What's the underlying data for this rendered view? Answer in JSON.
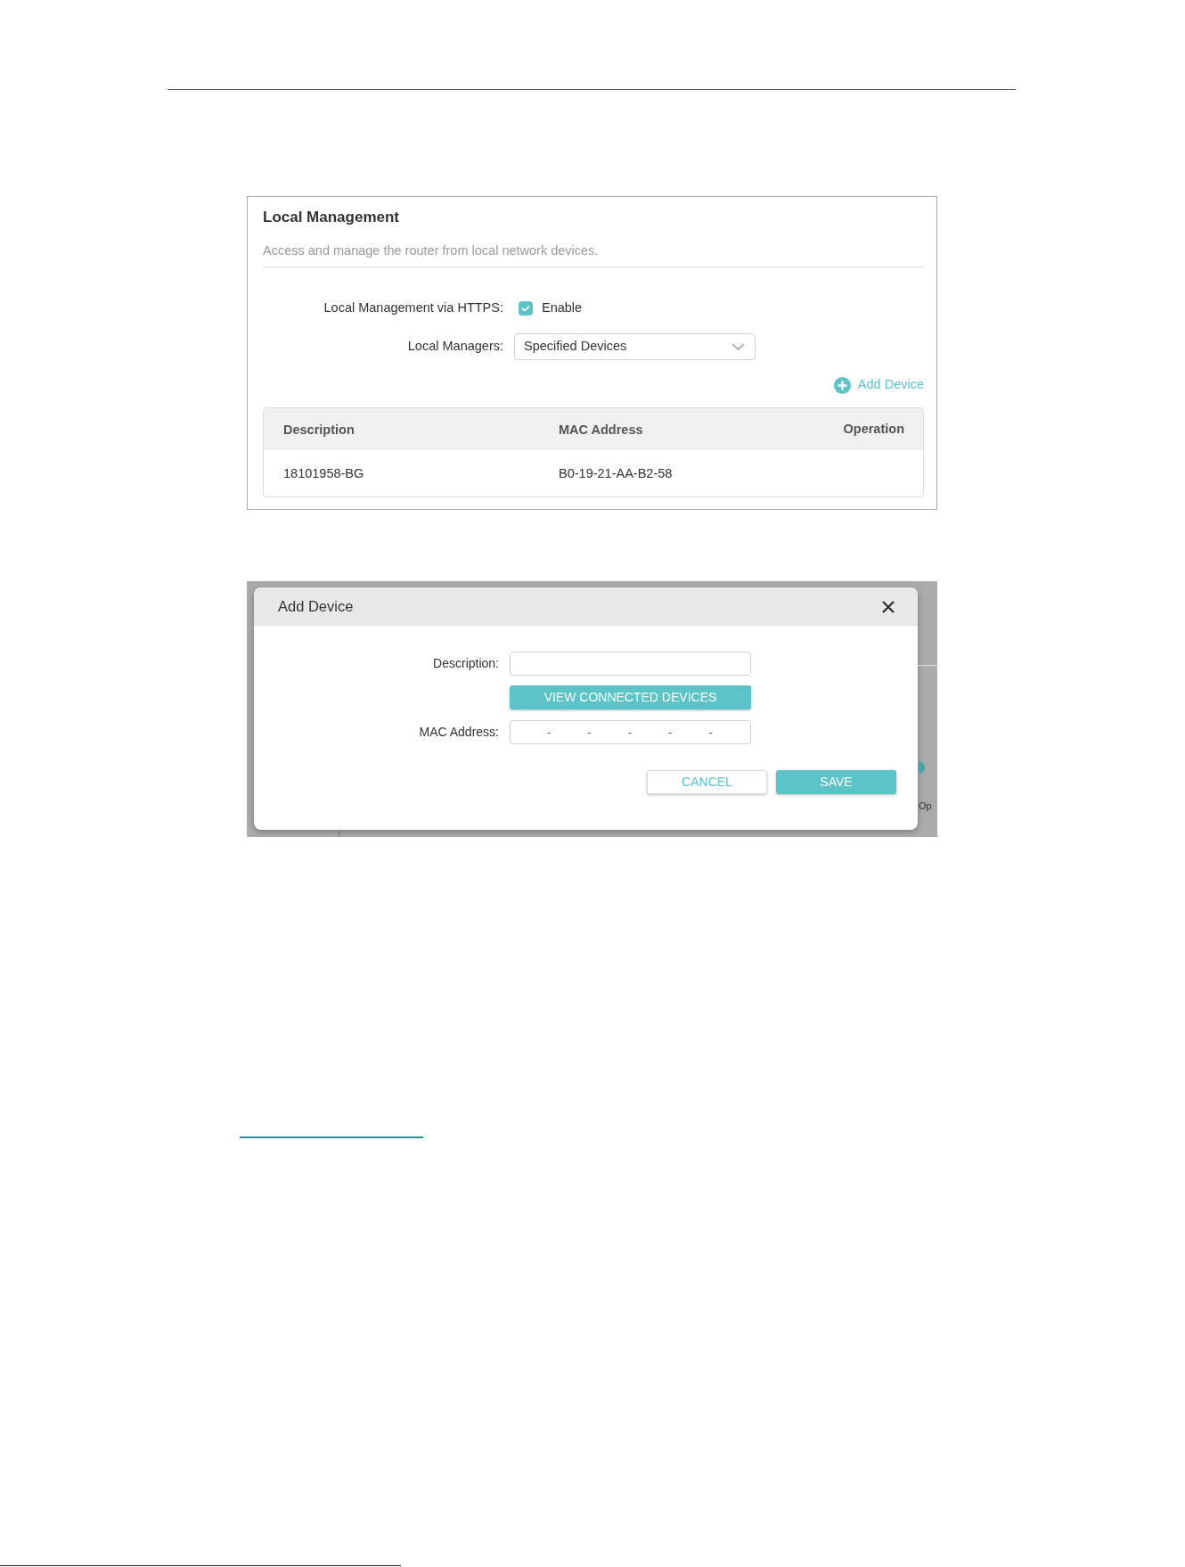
{
  "local_management": {
    "title": "Local Management",
    "description": "Access and manage the router from local network devices.",
    "https": {
      "label": "Local Management via HTTPS:",
      "checkbox_label": "Enable",
      "checked": true
    },
    "managers": {
      "label": "Local Managers:",
      "value": "Specified Devices"
    },
    "add_button": "Add Device",
    "table": {
      "columns": [
        "Description",
        "MAC Address",
        "Operation"
      ],
      "rows": [
        {
          "description": "18101958-BG",
          "mac_address": "B0-19-21-AA-B2-58"
        }
      ]
    }
  },
  "add_device_dialog": {
    "title": "Add Device",
    "items": [
      {
        "kind": "text_input",
        "label": "Description:"
      },
      {
        "kind": "button",
        "label": "VIEW CONNECTED DEVICES"
      },
      {
        "kind": "mac_input",
        "label": "MAC Address:",
        "separators": [
          "-",
          "-",
          "-",
          "-",
          "-"
        ]
      }
    ],
    "buttons": [
      {
        "kind": "secondary",
        "label": "CANCEL"
      },
      {
        "kind": "primary",
        "label": "SAVE"
      }
    ],
    "background_text": "Op"
  }
}
